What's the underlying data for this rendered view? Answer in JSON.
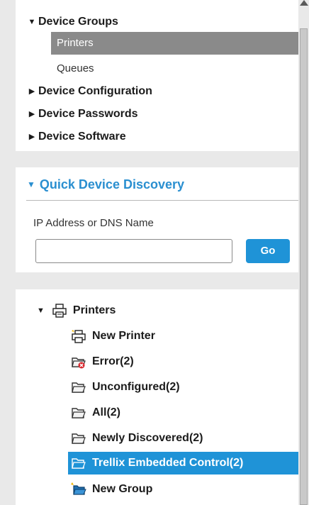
{
  "nav": {
    "device_groups": "Device Groups",
    "printers": "Printers",
    "queues": "Queues",
    "device_configuration": "Device Configuration",
    "device_passwords": "Device Passwords",
    "device_software": "Device Software"
  },
  "discovery": {
    "title": "Quick Device Discovery",
    "label": "IP Address or DNS Name",
    "input_value": "",
    "go": "Go"
  },
  "tree": {
    "root": "Printers",
    "items": [
      {
        "label": "New Printer",
        "icon": "new-printer-icon"
      },
      {
        "label": "Error(2)",
        "icon": "error-folder-icon"
      },
      {
        "label": "Unconfigured(2)",
        "icon": "folder-icon"
      },
      {
        "label": "All(2)",
        "icon": "folder-icon"
      },
      {
        "label": "Newly Discovered(2)",
        "icon": "folder-icon"
      },
      {
        "label": "Trellix Embedded Control(2)",
        "icon": "folder-icon",
        "selected": true
      },
      {
        "label": "New Group",
        "icon": "new-group-icon"
      }
    ]
  },
  "colors": {
    "accent": "#1f93d7",
    "selected_gray": "#8a8a8a",
    "background": "#e9e9e9"
  }
}
